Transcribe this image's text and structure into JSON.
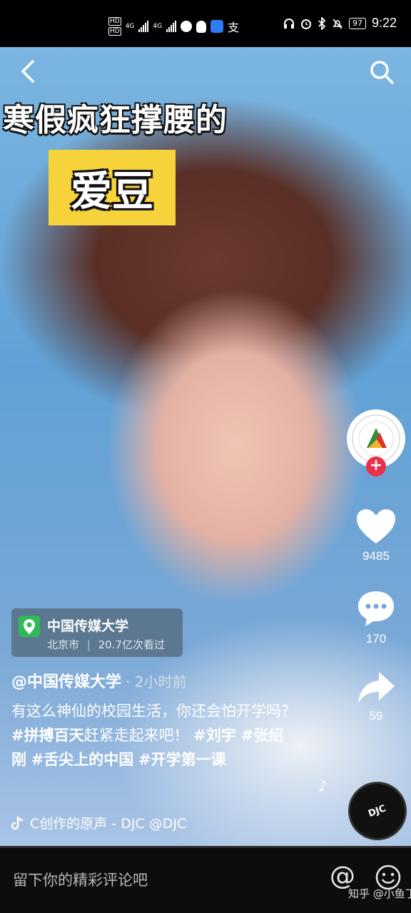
{
  "status_bar": {
    "time": "9:22",
    "battery": "97",
    "hd1": "HD",
    "hd2": "HD",
    "net1": "4G",
    "net2": "4G",
    "alipay": "支"
  },
  "video": {
    "title_line1": "寒假疯狂撑腰的",
    "title_line2": "爱豆"
  },
  "actions": {
    "likes": "9485",
    "comments": "170",
    "shares": "59",
    "follow": "+"
  },
  "location": {
    "name": "中国传媒大学",
    "city": "北京市",
    "views": "20.7亿次看过"
  },
  "post": {
    "author": "@中国传媒大学",
    "time": "· 2小时前",
    "caption_plain1": "有这么神仙的校园生活，你还会怕开学吗？",
    "hashtag1": "#拼搏百天",
    "caption_plain2": "赶紧走起来吧！",
    "hashtag2": "#刘宇",
    "hashtag3": "#张绍刚",
    "hashtag4": "#舌尖上的中国",
    "hashtag5": "#开学第一课",
    "music": "C创作的原声 - DJC    @DJC",
    "disc_label": "DJC"
  },
  "comment_bar": {
    "placeholder": "留下你的精彩评论吧",
    "at": "@",
    "watermark": "知乎 @小鱼丁人"
  },
  "colors": {
    "follow_red": "#e8304a",
    "location_green": "#2fba55",
    "title_yellow": "#f6d33a"
  },
  "icons": [
    "back-icon",
    "search-icon",
    "heart-icon",
    "comment-icon",
    "share-icon",
    "music-note-icon",
    "emoji-icon",
    "location-pin-icon"
  ]
}
